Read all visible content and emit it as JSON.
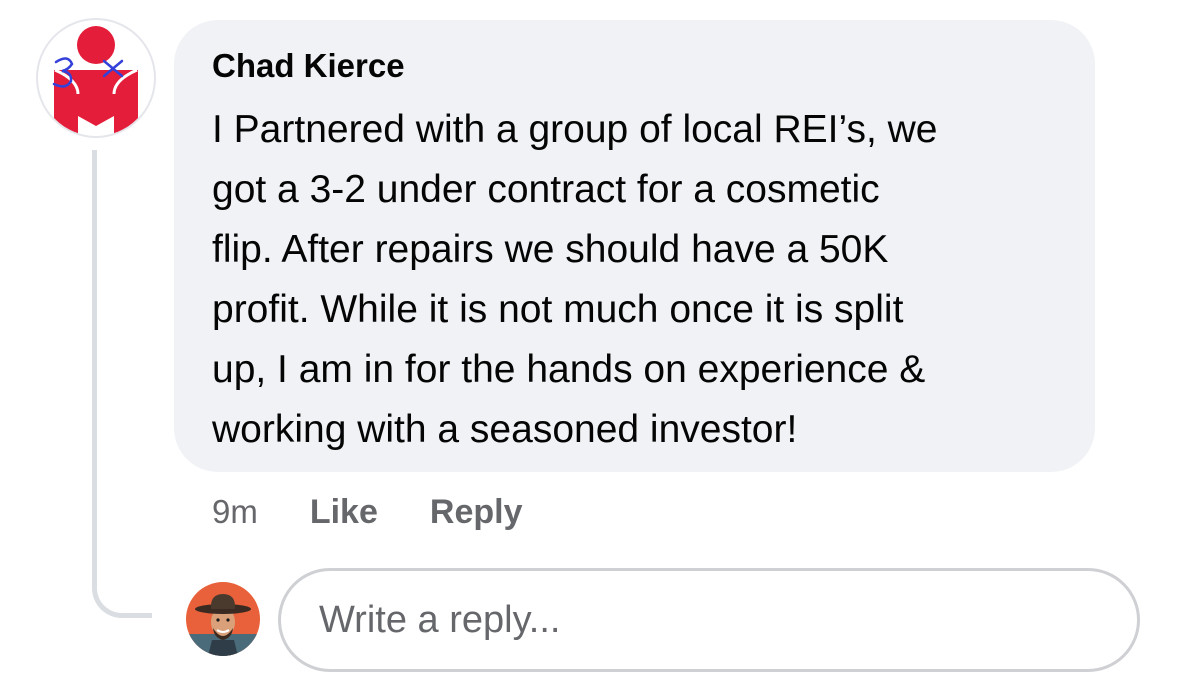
{
  "comment": {
    "author": "Chad Kierce",
    "text": "I Partnered with a group of local REI’s, we\ngot a 3-2 under contract for a cosmetic\nflip.  After repairs we should have a 50K\nprofit.  While it is not much once it is split\nup, I am in for the hands on experience &\nworking with a seasoned investor!",
    "time": "9m",
    "like_label": "Like",
    "reply_label": "Reply",
    "avatar_icon": "ironman-logo-avatar",
    "avatar_handwriting": "3x"
  },
  "reply": {
    "placeholder": "Write a reply...",
    "avatar_icon": "user-avatar-cowboy-hat"
  },
  "colors": {
    "bubble": "#f0f2f5",
    "secondary_text": "#65676b",
    "logo_red": "#e41e3a",
    "handwriting_blue": "#3340d9"
  }
}
